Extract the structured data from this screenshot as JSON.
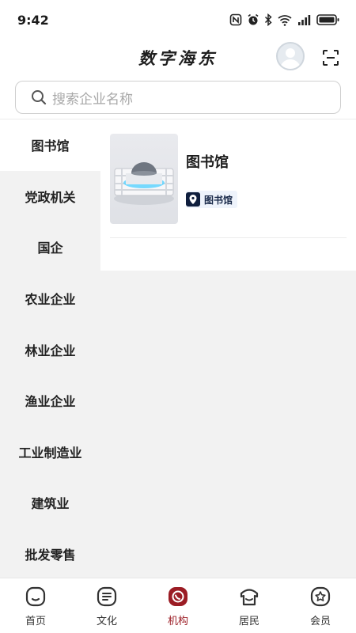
{
  "status_bar": {
    "time": "9:42",
    "icons": [
      "nfc-icon",
      "alarm-icon",
      "bluetooth-icon",
      "wifi-icon",
      "signal-icon",
      "battery-icon"
    ]
  },
  "header": {
    "title": "数字海东",
    "avatar_icon": "avatar-icon",
    "scan_icon": "scan-icon"
  },
  "search": {
    "placeholder": "搜索企业名称"
  },
  "sidebar": {
    "items": [
      {
        "label": "图书馆",
        "active": true
      },
      {
        "label": "党政机关",
        "active": false
      },
      {
        "label": "国企",
        "active": false
      },
      {
        "label": "农业企业",
        "active": false
      },
      {
        "label": "林业企业",
        "active": false
      },
      {
        "label": "渔业企业",
        "active": false
      },
      {
        "label": "工业制造业",
        "active": false
      },
      {
        "label": "建筑业",
        "active": false
      },
      {
        "label": "批发零售",
        "active": false
      }
    ]
  },
  "results": [
    {
      "title": "图书馆",
      "tag": "图书馆",
      "tag_icon": "location-pin-icon"
    }
  ],
  "bottom_nav": {
    "tabs": [
      {
        "label": "首页",
        "icon": "home-icon",
        "active": false
      },
      {
        "label": "文化",
        "icon": "culture-icon",
        "active": false
      },
      {
        "label": "机构",
        "icon": "institution-icon",
        "active": true
      },
      {
        "label": "居民",
        "icon": "resident-icon",
        "active": false
      },
      {
        "label": "会员",
        "icon": "member-icon",
        "active": false
      }
    ]
  },
  "colors": {
    "accent": "#9b1c24",
    "sidebar_bg": "#f2f2f2",
    "tag_bg": "#eef3fb",
    "tag_icon_bg": "#0f1e3d"
  }
}
